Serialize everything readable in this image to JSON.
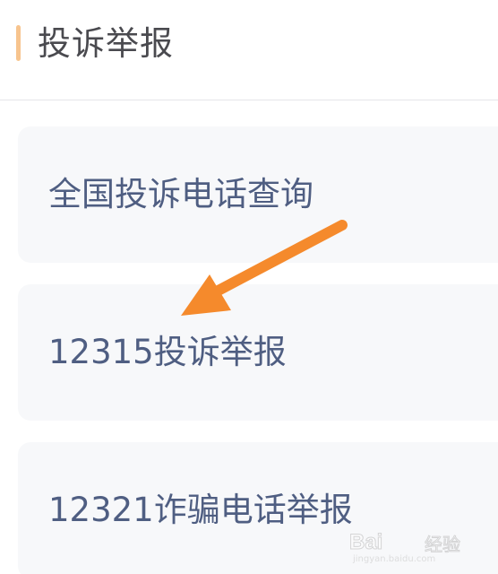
{
  "header": {
    "title": "投诉举报",
    "accent_color": "#f7c48e"
  },
  "menu": {
    "items": [
      {
        "label": "全国投诉电话查询"
      },
      {
        "label": "12315投诉举报"
      },
      {
        "label": "12321诈骗电话举报"
      }
    ]
  },
  "annotation": {
    "arrow_color": "#f58a2c"
  },
  "watermark": {
    "brand": "Bai",
    "sub": "经验",
    "url": "jingyan.baidu.com"
  }
}
